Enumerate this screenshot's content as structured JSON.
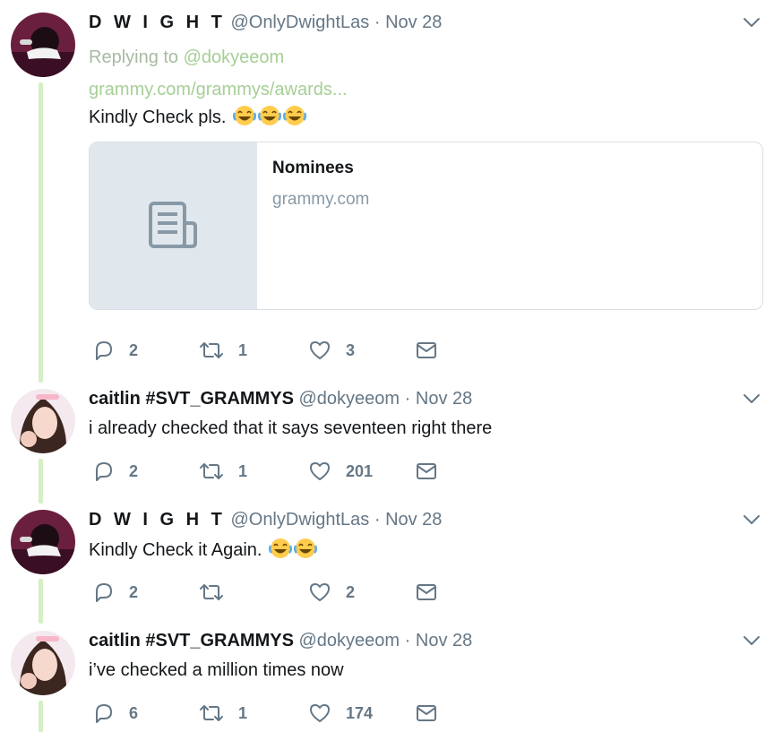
{
  "tweets": [
    {
      "name": "D W I G H T",
      "handle": "@OnlyDwightLas",
      "separator": "·",
      "date": "Nov 28",
      "replying_prefix": "Replying to",
      "replying_to": "@dokyeeom",
      "link_text": "grammy.com/grammys/awards...",
      "text": "Kindly Check pls.",
      "emoji": "face-with-tears-of-joy x3",
      "card": {
        "title": "Nominees",
        "domain": "grammy.com"
      },
      "replies": "2",
      "retweets": "1",
      "likes": "3"
    },
    {
      "name": "caitlin #SVT_GRAMMYS",
      "handle": "@dokyeeom",
      "separator": "·",
      "date": "Nov 28",
      "text": "i already checked that it says seventeen right there",
      "replies": "2",
      "retweets": "1",
      "likes": "201"
    },
    {
      "name": "D W I G H T",
      "handle": "@OnlyDwightLas",
      "separator": "·",
      "date": "Nov 28",
      "text": "Kindly Check it Again.",
      "emoji": "face-with-tears-of-joy x2",
      "replies": "2",
      "retweets": "",
      "likes": "2"
    },
    {
      "name": "caitlin #SVT_GRAMMYS",
      "handle": "@dokyeeom",
      "separator": "·",
      "date": "Nov 28",
      "text": "i’ve checked a million times now",
      "replies": "6",
      "retweets": "1",
      "likes": "174"
    }
  ],
  "colors": {
    "thread_line": "#d4efc4",
    "link": "#a6cf95",
    "muted": "#657786",
    "icon": "#657786"
  },
  "icons": [
    "reply-icon",
    "retweet-icon",
    "like-icon",
    "dm-icon",
    "chevron-down-icon",
    "article-icon"
  ]
}
